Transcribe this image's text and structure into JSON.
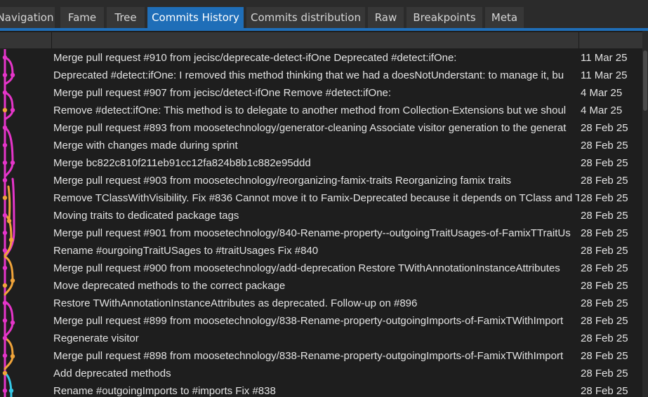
{
  "tabs": [
    {
      "label": "Navigation",
      "active": false
    },
    {
      "label": "Fame",
      "active": false
    },
    {
      "label": "Tree",
      "active": false
    },
    {
      "label": "Commits History",
      "active": true
    },
    {
      "label": "Commits distribution",
      "active": false
    },
    {
      "label": "Raw",
      "active": false
    },
    {
      "label": "Breakpoints",
      "active": false
    },
    {
      "label": "Meta",
      "active": false
    }
  ],
  "graph": {
    "icon": "commit-graph-icon",
    "colors": {
      "magenta": "#e535c9",
      "orange": "#f0a43a",
      "cyan": "#35c8e6"
    }
  },
  "commits": [
    {
      "message": "Merge pull request #910 from jecisc/deprecate-detect-ifOne  Deprecated #detect:ifOne:",
      "date": "11 Mar 25"
    },
    {
      "message": "Deprecated #detect:ifOne:  I removed this method thinking that we had a doesNotUnderstant: to manage it, bu",
      "date": "11 Mar 25"
    },
    {
      "message": "Merge pull request #907 from jecisc/detect-ifOne  Remove #detect:ifOne:",
      "date": "4 Mar 25"
    },
    {
      "message": "Remove #detect:ifOne:  This method is to delegate to another method from Collection-Extensions but we shoul",
      "date": "4 Mar 25"
    },
    {
      "message": "Merge pull request #893 from moosetechnology/generator-cleaning  Associate visitor generation to the generat",
      "date": "28 Feb 25"
    },
    {
      "message": "Merge with changes made during sprint",
      "date": "28 Feb 25"
    },
    {
      "message": "Merge bc822c810f211eb91cc12fa824b8b1c882e95ddd",
      "date": "28 Feb 25"
    },
    {
      "message": "Merge pull request #903 from moosetechnology/reorganizing-famix-traits  Reorganizing famix traits",
      "date": "28 Feb 25"
    },
    {
      "message": "Remove TClassWithVisibility. Fix #836 Cannot move it to Famix-Deprecated because it depends on TClass and T",
      "date": "28 Feb 25"
    },
    {
      "message": "Moving traits to dedicated package tags",
      "date": "28 Feb 25"
    },
    {
      "message": "Merge pull request #901 from moosetechnology/840-Rename-property--outgoingTraitUsages-of-FamixTTraitUs",
      "date": "28 Feb 25"
    },
    {
      "message": "Rename #ourgoingTraitUSages to #traitUsages Fix #840",
      "date": "28 Feb 25"
    },
    {
      "message": "Merge pull request #900 from moosetechnology/add-deprecation  Restore TWithAnnotationInstanceAttributes",
      "date": "28 Feb 25"
    },
    {
      "message": "Move deprecated methods to the correct package",
      "date": "28 Feb 25"
    },
    {
      "message": "Restore TWithAnnotationInstanceAttributes as deprecated. Follow-up on #896",
      "date": "28 Feb 25"
    },
    {
      "message": "Merge pull request #899 from moosetechnology/838-Rename-property-outgoingImports-of-FamixTWithImport",
      "date": "28 Feb 25"
    },
    {
      "message": "Regenerate visitor",
      "date": "28 Feb 25"
    },
    {
      "message": "Merge pull request #898 from moosetechnology/838-Rename-property-outgoingImports-of-FamixTWithImport",
      "date": "28 Feb 25"
    },
    {
      "message": "Add deprecated methods",
      "date": "28 Feb 25"
    },
    {
      "message": "Rename #outgoingImports to #imports Fix #838",
      "date": "28 Feb 25"
    }
  ]
}
